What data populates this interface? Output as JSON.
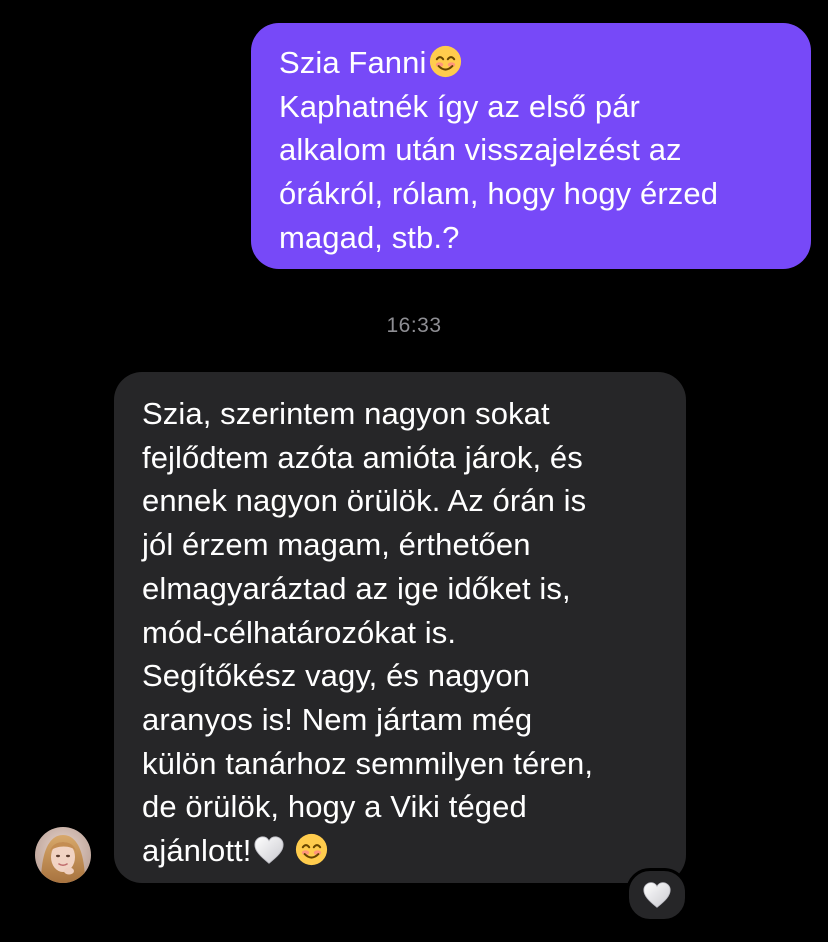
{
  "conversation": {
    "outgoing": {
      "lines": [
        "Szia Fanni",
        "Kaphatnék így az első pár",
        "alkalom után visszajelzést az",
        "órákról, rólam, hogy hogy érzed",
        "magad, stb.?"
      ],
      "emoji_after_line_1": "smiling-face-icon"
    },
    "timestamp": "16:33",
    "incoming": {
      "lines": [
        "Szia, szerintem nagyon sokat",
        "fejlődtem azóta amióta járok, és",
        "ennek nagyon örülök. Az órán is",
        "jól érzem magam, érthetően",
        "elmagyaráztad az ige időket is,",
        "mód-célhatározókat is.",
        "Segítőkész vagy, és nagyon",
        "aranyos is! Nem jártam még",
        "külön tanárhoz semmilyen téren,",
        "de örülök, hogy a Viki téged",
        "ajánlott!"
      ],
      "emoji_after_last_line": [
        "white-heart-icon",
        "smiling-face-icon"
      ],
      "reaction": "white-heart-icon"
    }
  },
  "colors": {
    "background": "#000000",
    "outgoing_bubble": "#7749f8",
    "incoming_bubble": "#262628",
    "text": "#ffffff",
    "timestamp": "#8e8e93"
  }
}
